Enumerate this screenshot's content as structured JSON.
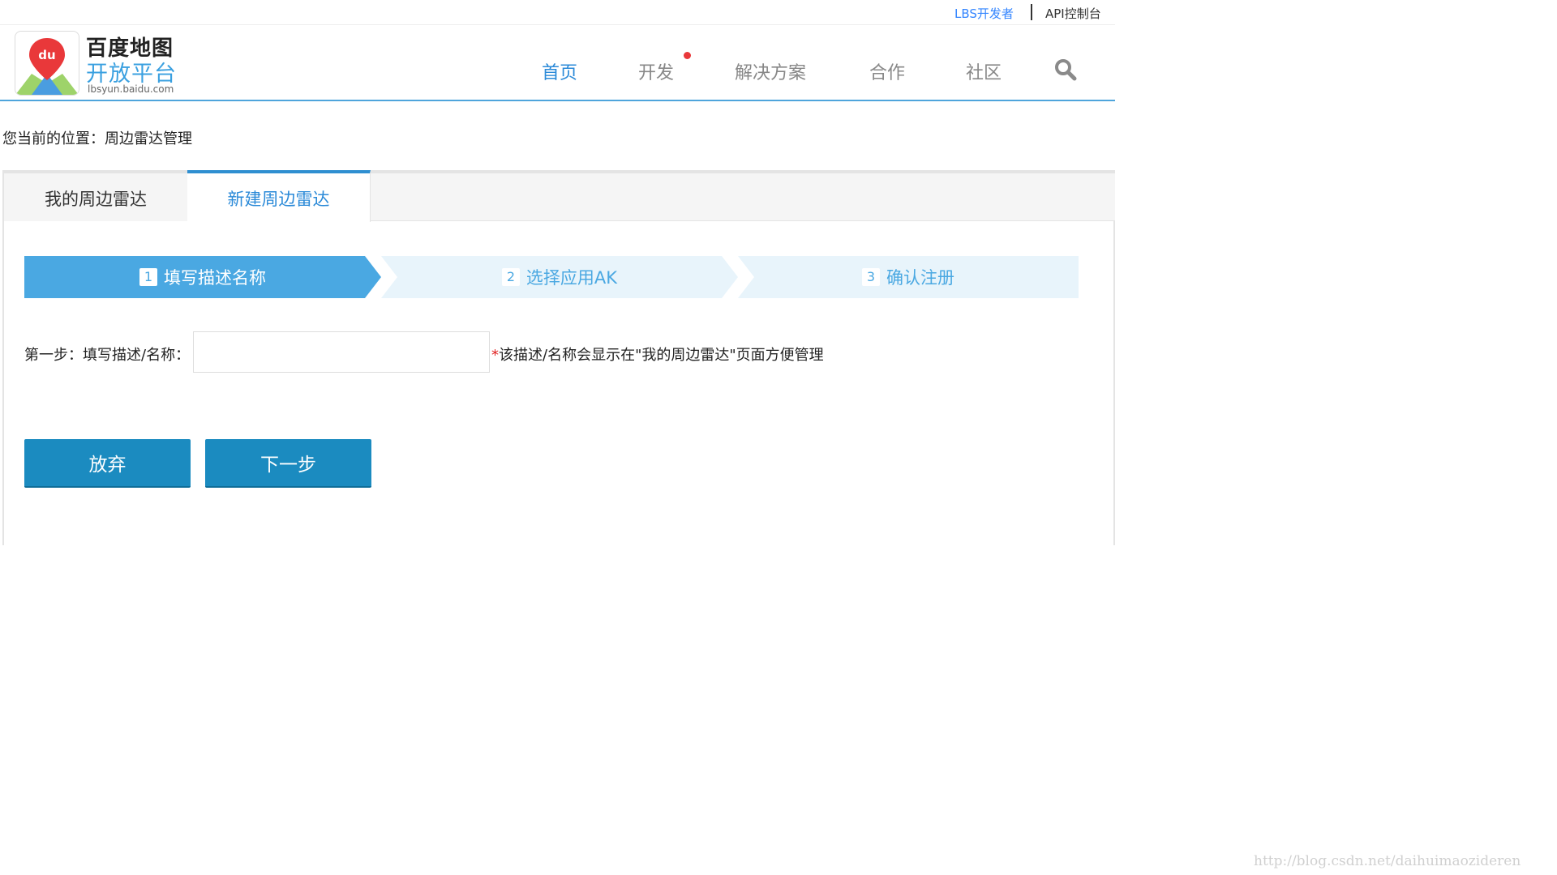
{
  "topbar": {
    "developer_link": "LBS开发者",
    "api_console_link": "API控制台"
  },
  "header": {
    "logo_badge": "du",
    "logo_title": "百度地图",
    "logo_subtitle": "开放平台",
    "logo_url": "lbsyun.baidu.com",
    "nav": [
      {
        "label": "首页",
        "active": true
      },
      {
        "label": "开发",
        "active": false,
        "has_notification_dot": true
      },
      {
        "label": "解决方案",
        "active": false
      },
      {
        "label": "合作",
        "active": false
      },
      {
        "label": "社区",
        "active": false
      }
    ],
    "search_icon": "search-icon",
    "accent_color": "#2b8ad8"
  },
  "breadcrumb": {
    "prefix": "您当前的位置：",
    "current": "周边雷达管理"
  },
  "tabs": [
    {
      "label": "我的周边雷达",
      "active": false
    },
    {
      "label": "新建周边雷达",
      "active": true
    }
  ],
  "steps": [
    {
      "number": "1",
      "label": "填写描述名称",
      "active": true
    },
    {
      "number": "2",
      "label": "选择应用AK",
      "active": false
    },
    {
      "number": "3",
      "label": "确认注册",
      "active": false
    }
  ],
  "form": {
    "label": "第一步：填写描述/名称：",
    "input_value": "",
    "required_mark": "*",
    "hint": "该描述/名称会显示在\"我的周边雷达\"页面方便管理"
  },
  "buttons": {
    "cancel": "放弃",
    "next": "下一步"
  },
  "watermark": "http://blog.csdn.net/daihuimaozideren"
}
